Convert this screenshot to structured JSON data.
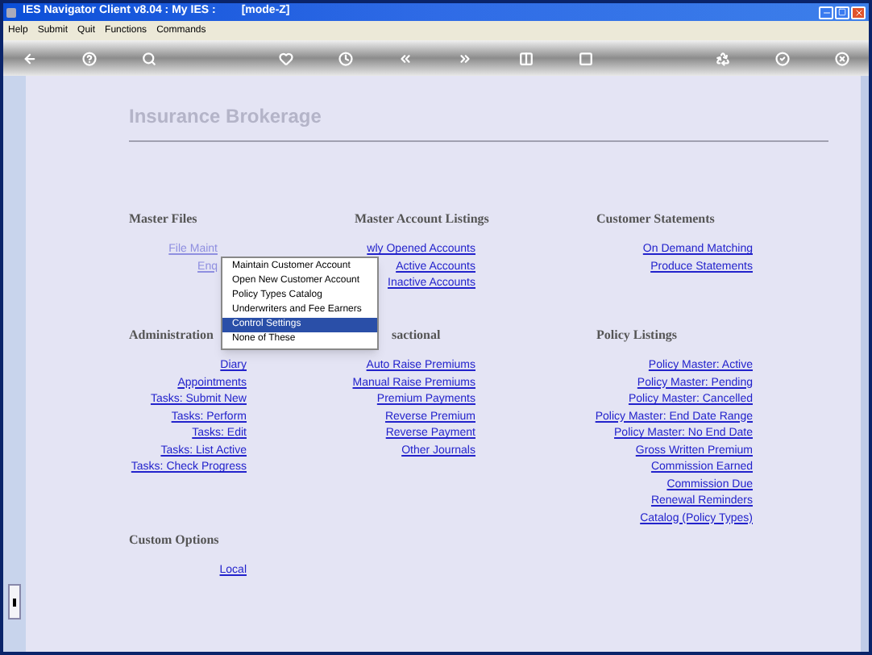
{
  "window": {
    "title": "IES Navigator Client v8.04 : My IES :",
    "mode": "[mode-Z]"
  },
  "menu_bar": [
    "Help",
    "Submit",
    "Quit",
    "Functions",
    "Commands"
  ],
  "page_title": "Insurance Brokerage",
  "section_rows": [
    [
      {
        "heading": "Master Files",
        "links": [
          "File Maint",
          "Enq"
        ]
      },
      {
        "heading": "Master Account Listings",
        "links": [
          "wly Opened Accounts",
          "Active Accounts",
          "Inactive Accounts"
        ]
      },
      {
        "heading": "Customer Statements",
        "links": [
          "On Demand Matching",
          "Produce Statements"
        ]
      }
    ],
    [
      {
        "heading": "Administration",
        "links": [
          "Diary",
          "Appointments",
          "Tasks: Submit New",
          "Tasks: Perform",
          "Tasks: Edit",
          "Tasks: List Active",
          "Tasks: Check Progress"
        ]
      },
      {
        "heading": "sactional",
        "links": [
          "Auto Raise Premiums",
          "Manual Raise Premiums",
          "Premium Payments",
          "Reverse Premium",
          "Reverse Payment",
          "Other Journals"
        ]
      },
      {
        "heading": "Policy Listings",
        "links": [
          "Policy Master: Active",
          "Policy Master: Pending",
          "Policy Master: Cancelled",
          "Policy Master: End Date Range",
          "Policy Master: No End Date",
          "Gross Written Premium",
          "Commission Earned",
          "Commission Due",
          "Renewal Reminders",
          "Catalog (Policy Types)"
        ]
      }
    ],
    [
      {
        "heading": "Custom Options",
        "links": [
          "Local"
        ]
      }
    ]
  ],
  "popup_menu": [
    {
      "label": "Maintain Customer Account",
      "selected": false
    },
    {
      "label": "Open New Customer Account",
      "selected": false
    },
    {
      "label": "Policy Types Catalog",
      "selected": false
    },
    {
      "label": "Underwriters and Fee Earners",
      "selected": false
    },
    {
      "label": "Control Settings",
      "selected": true
    },
    {
      "label": "None of These",
      "selected": false
    }
  ]
}
